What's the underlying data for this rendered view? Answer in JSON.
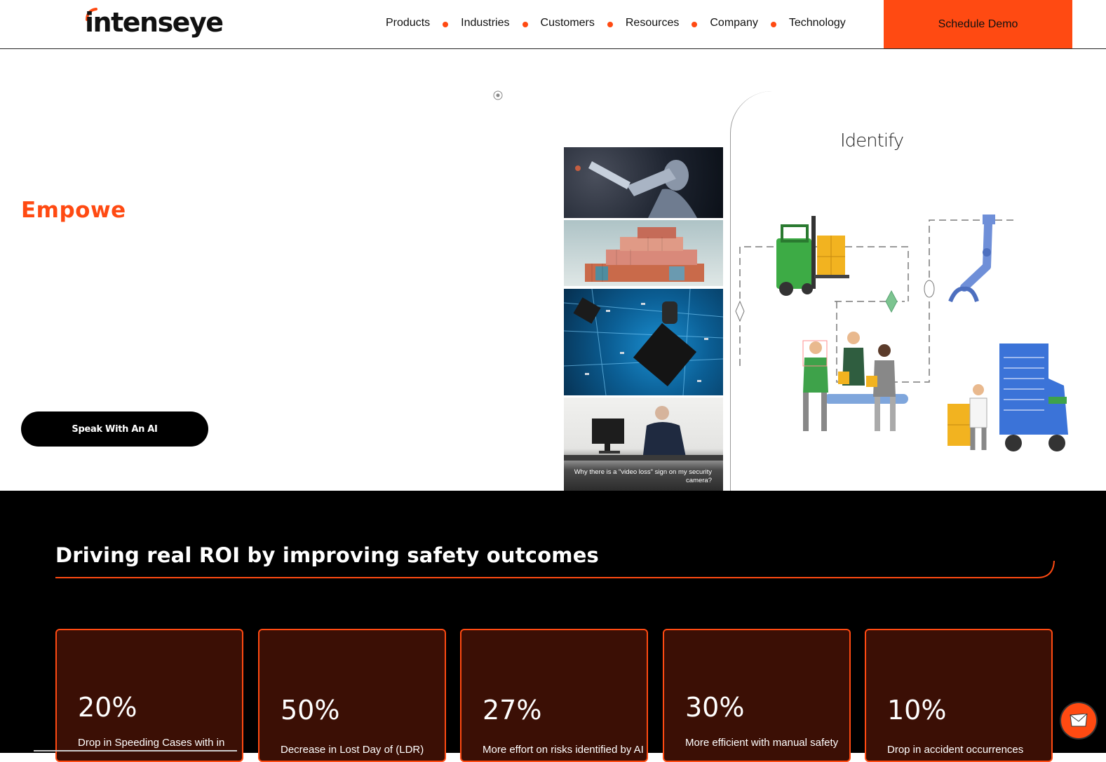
{
  "brand": {
    "logo_text": "intenseye",
    "accent": "#ff4a12"
  },
  "nav": {
    "items": [
      "Products",
      "Industries",
      "Customers",
      "Resources",
      "Company",
      "Technology"
    ],
    "demo_label": "Schedule Demo"
  },
  "hero": {
    "title": "Empowe",
    "cta_label": "Speak With An AI",
    "image_caption": "Why there is a \"video loss\" sign on my security camera?",
    "panel_title": "Identify"
  },
  "roi": {
    "title": "Driving real ROI by improving safety outcomes",
    "cards": [
      {
        "value": "20%",
        "desc": "Drop in Speeding Cases with in"
      },
      {
        "value": "50%",
        "desc": "Decrease in Lost Day of (LDR)"
      },
      {
        "value": "27%",
        "desc": "More effort on risks identified by AI"
      },
      {
        "value": "30%",
        "desc": "More efficient with manual safety"
      },
      {
        "value": "10%",
        "desc": "Drop in accident occurrences"
      }
    ]
  }
}
